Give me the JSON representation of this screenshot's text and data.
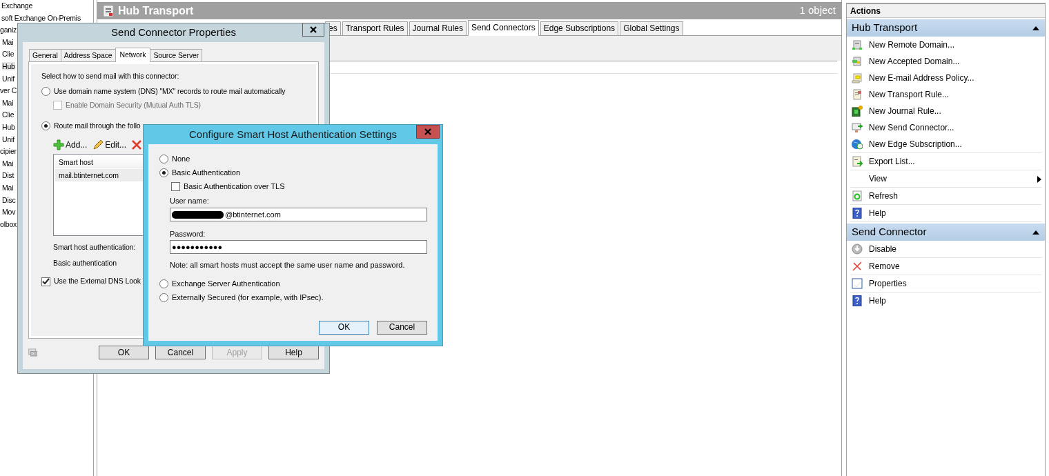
{
  "nav_tree": {
    "items": [
      {
        "label": "Exchange",
        "selected": false
      },
      {
        "label": "soft Exchange On-Premis",
        "selected": false,
        "children": [
          {
            "label": "ganiz",
            "selected": false,
            "children": [
              {
                "label": "Mai",
                "selected": false
              },
              {
                "label": "Clie",
                "selected": false
              },
              {
                "label": "Hub",
                "selected": true
              },
              {
                "label": "Unif",
                "selected": false
              }
            ]
          },
          {
            "label": "ver C",
            "selected": false,
            "children": [
              {
                "label": "Mai",
                "selected": false
              },
              {
                "label": "Clie",
                "selected": false
              },
              {
                "label": "Hub",
                "selected": false
              },
              {
                "label": "Unif",
                "selected": false
              }
            ]
          },
          {
            "label": "cipier",
            "selected": false,
            "children": [
              {
                "label": "Mai",
                "selected": false
              },
              {
                "label": "Dist",
                "selected": false
              },
              {
                "label": "Mai",
                "selected": false
              },
              {
                "label": "Disc",
                "selected": false
              },
              {
                "label": "Mov",
                "selected": false
              }
            ]
          },
          {
            "label": "olbox",
            "selected": false
          }
        ]
      }
    ]
  },
  "main_pane": {
    "title": "Hub Transport",
    "count": "1 object",
    "tabs": [
      {
        "label": "es",
        "selected": false
      },
      {
        "label": "Transport Rules",
        "selected": false
      },
      {
        "label": "Journal Rules",
        "selected": false
      },
      {
        "label": "Send Connectors",
        "selected": true
      },
      {
        "label": "Edge Subscriptions",
        "selected": false
      },
      {
        "label": "Global Settings",
        "selected": false
      }
    ]
  },
  "actions_pane": {
    "title": "Actions",
    "sections": [
      {
        "title": "Hub Transport",
        "expanded": true,
        "groups": [
          [
            {
              "label": "New Remote Domain...",
              "kind": "action"
            },
            {
              "label": "New Accepted Domain...",
              "kind": "action"
            },
            {
              "label": "New E-mail Address Policy...",
              "kind": "action"
            },
            {
              "label": "New Transport Rule...",
              "kind": "action"
            },
            {
              "label": "New Journal Rule...",
              "kind": "action"
            },
            {
              "label": "New Send Connector...",
              "kind": "action"
            },
            {
              "label": "New Edge Subscription...",
              "kind": "action"
            }
          ],
          [
            {
              "label": "Export List...",
              "kind": "action"
            }
          ],
          [
            {
              "label": "View",
              "kind": "submenu"
            }
          ],
          [
            {
              "label": "Refresh",
              "kind": "action"
            }
          ],
          [
            {
              "label": "Help",
              "kind": "action"
            }
          ]
        ]
      },
      {
        "title": "Send Connector",
        "expanded": true,
        "groups": [
          [
            {
              "label": "Disable",
              "kind": "action"
            }
          ],
          [
            {
              "label": "Remove",
              "kind": "action"
            }
          ],
          [
            {
              "label": "Properties",
              "kind": "action"
            }
          ],
          [
            {
              "label": "Help",
              "kind": "action"
            }
          ]
        ]
      }
    ]
  },
  "send_connector_dialog": {
    "title": "Send Connector Properties",
    "tabs": [
      {
        "label": "General",
        "selected": false
      },
      {
        "label": "Address Space",
        "selected": false
      },
      {
        "label": "Network",
        "selected": true
      },
      {
        "label": "Source Server",
        "selected": false
      }
    ],
    "prompt": "Select how to send mail with this connector:",
    "options": [
      {
        "kind": "radio",
        "label": "Use domain name system (DNS) \"MX\" records to route mail automatically",
        "selected": false
      },
      {
        "kind": "checkbox",
        "label": "Enable Domain Security (Mutual Auth TLS)",
        "checked": false,
        "disabled": true
      },
      {
        "kind": "radio",
        "label": "Route mail through the follo",
        "selected": true
      }
    ],
    "toolbar": [
      "Add...",
      "Edit..."
    ],
    "smart_hosts": {
      "columns": [
        "Smart host"
      ],
      "rows": [
        {
          "host": "mail.btinternet.com",
          "selected": true
        }
      ]
    },
    "auth_label": "Smart host authentication:",
    "auth_value": "Basic authentication",
    "external_dns": {
      "label": "Use the External DNS Look",
      "checked": true
    },
    "buttons": [
      {
        "label": "OK",
        "disabled": false
      },
      {
        "label": "Cancel",
        "disabled": false
      },
      {
        "label": "Apply",
        "disabled": true
      },
      {
        "label": "Help",
        "disabled": false
      }
    ]
  },
  "auth_dialog": {
    "title": "Configure Smart Host Authentication Settings",
    "options": [
      {
        "kind": "radio",
        "label": "None",
        "selected": false
      },
      {
        "kind": "radio",
        "label": "Basic Authentication",
        "selected": true
      },
      {
        "kind": "checkbox",
        "label": "Basic Authentication over TLS",
        "checked": false,
        "disabled": false
      }
    ],
    "username": {
      "label": "User name:",
      "value": "@btinternet.com"
    },
    "password": {
      "label": "Password:",
      "value": "●●●●●●●●●●●"
    },
    "note": "Note: all smart hosts must accept the same user name and password.",
    "options_after": [
      {
        "kind": "radio",
        "label": "Exchange Server Authentication",
        "selected": false
      },
      {
        "kind": "radio",
        "label": "Externally Secured (for example, with IPsec).",
        "selected": false
      }
    ],
    "buttons": [
      {
        "label": "OK",
        "default": true
      },
      {
        "label": "Cancel",
        "default": false
      }
    ]
  }
}
